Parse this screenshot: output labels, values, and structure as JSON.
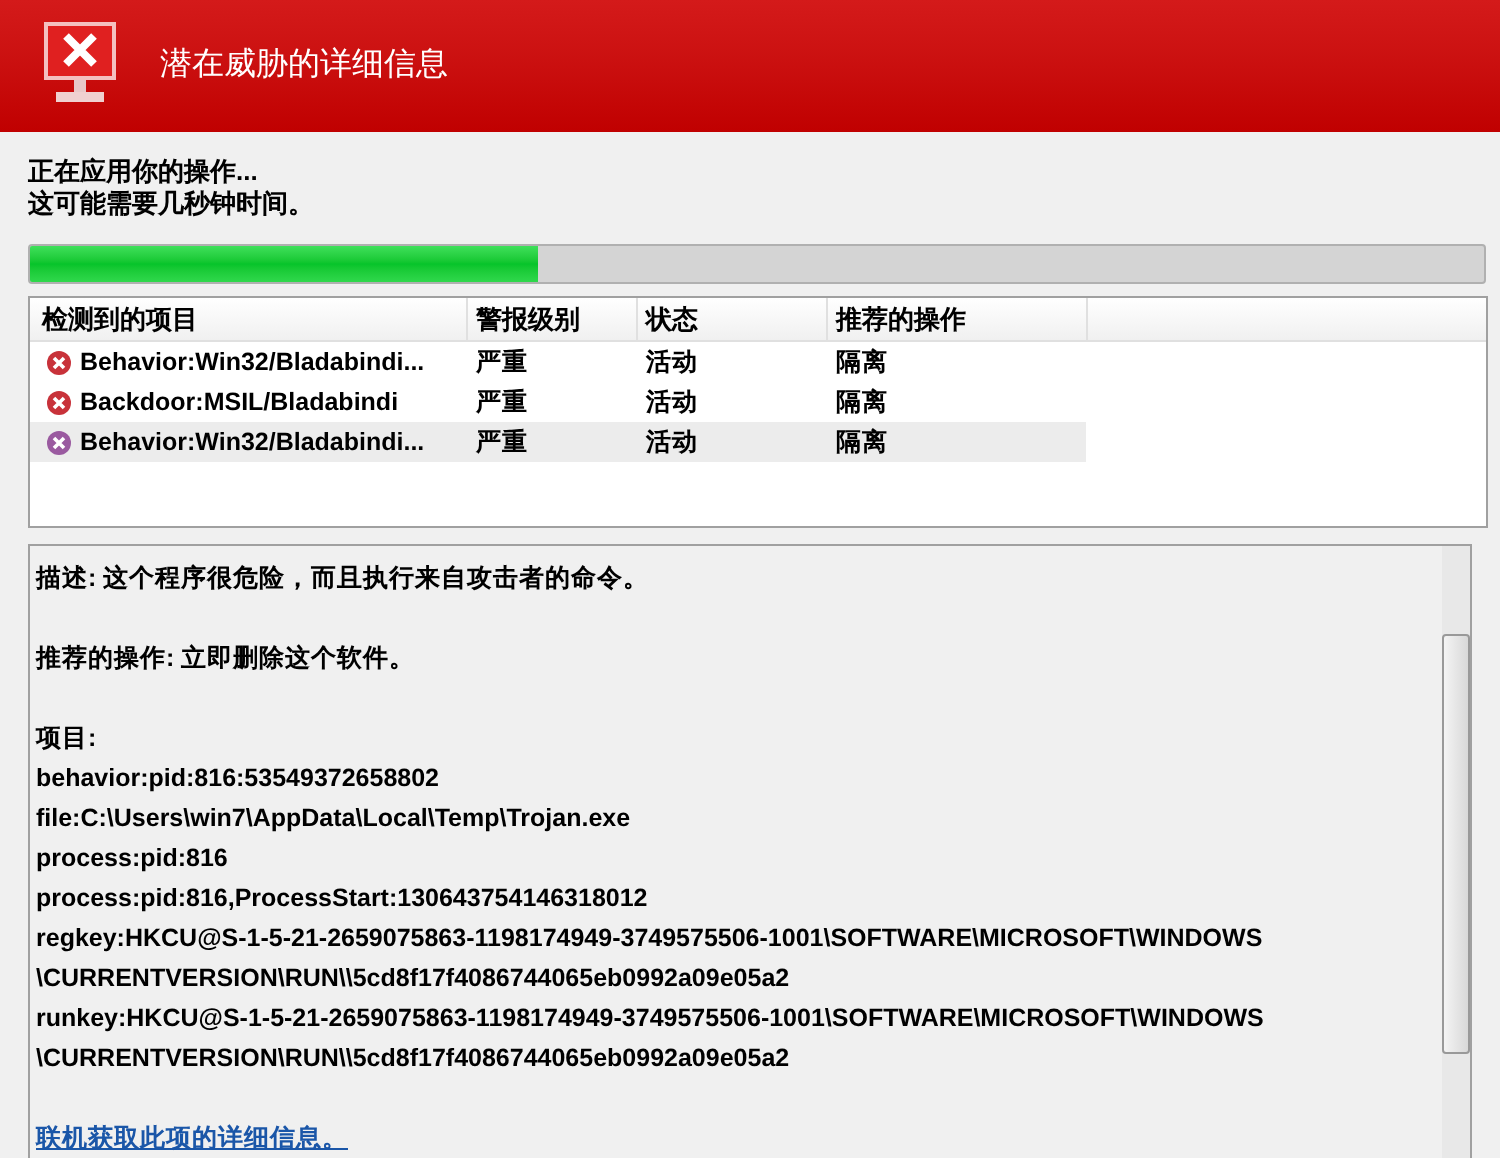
{
  "window": {
    "title": "潜在威胁的详细信息"
  },
  "status": [
    "正在应用你的操作...",
    "这可能需要几秒钟时间。"
  ],
  "progress": {
    "level": 0.35
  },
  "table": {
    "columns": [
      "检测到的项目",
      "警报级别",
      "状态",
      "推荐的操作"
    ],
    "rows": [
      {
        "cells": [
          "Behavior:Win32/Bladabindi...",
          "严重",
          "活动",
          "隔离"
        ],
        "selected": false
      },
      {
        "cells": [
          "Backdoor:MSIL/Bladabindi",
          "严重",
          "活动",
          "隔离"
        ],
        "selected": false
      },
      {
        "cells": [
          "Behavior:Win32/Bladabindi...",
          "严重",
          "活动",
          "隔离"
        ],
        "selected": true
      }
    ]
  },
  "details": {
    "description": "描述: 这个程序很危险，而且执行来自攻击者的命令。",
    "recommendation": "推荐的操作: 立即删除这个软件。",
    "items_label": "项目:",
    "items": [
      "behavior:pid:816:53549372658802",
      "file:C:\\Users\\win7\\AppData\\Local\\Temp\\Trojan.exe",
      "process:pid:816",
      "process:pid:816,ProcessStart:130643754146318012",
      "regkey:HKCU@S-1-5-21-2659075863-1198174949-3749575506-1001\\SOFTWARE\\MICROSOFT\\WINDOWS \\CURRENTVERSION\\RUN\\\\5cd8f17f4086744065eb0992a09e05a2",
      "runkey:HKCU@S-1-5-21-2659075863-1198174949-3749575506-1001\\SOFTWARE\\MICROSOFT\\WINDOWS \\CURRENTVERSION\\RUN\\\\5cd8f17f4086744065eb0992a09e05a2"
    ],
    "link": "联机获取此项的详细信息。"
  }
}
